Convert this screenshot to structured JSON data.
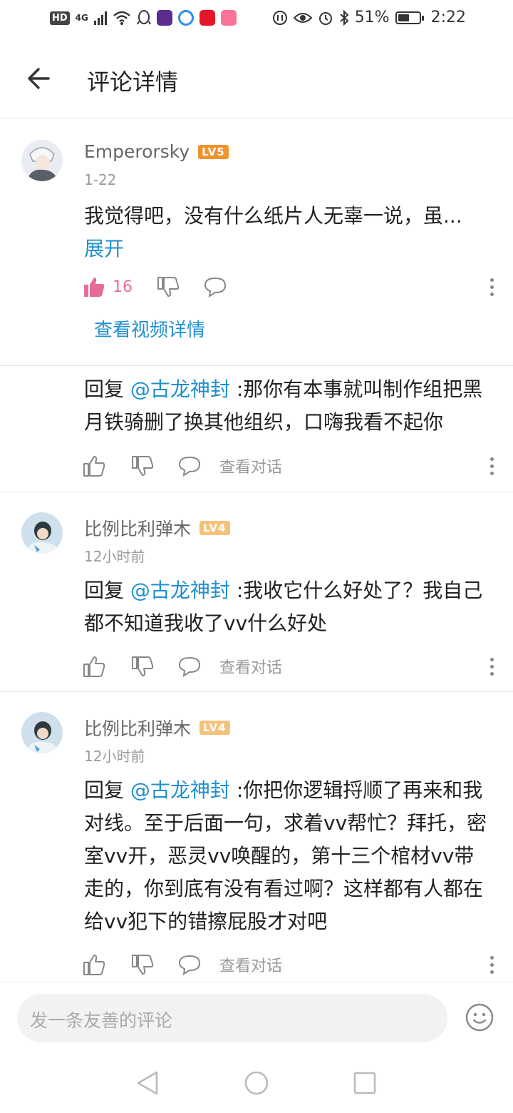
{
  "status_bar": {
    "hd": "HD",
    "network": "4G",
    "battery": "51%",
    "battery_level": 0.51,
    "time": "2:22"
  },
  "header": {
    "title": "评论详情"
  },
  "comments": [
    {
      "user": "Emperorsky",
      "level": "LV5",
      "level_color": "#f0932b",
      "date": "1-22",
      "text": "我觉得吧，没有什么纸片人无辜一说，虽...",
      "expand": "展开",
      "likes": "16",
      "video_link": "查看视频详情"
    },
    {
      "reply_prefix": "回复 ",
      "mention": "@古龙神封",
      "text": " :那你有本事就叫制作组把黑月铁骑删了换其他组织，口嗨我看不起你",
      "view_conversation": "查看对话"
    },
    {
      "user": "比例比利弹木",
      "level": "LV4",
      "level_color": "#f5c27a",
      "date": "12小时前",
      "reply_prefix": "回复 ",
      "mention": "@古龙神封",
      "text": " :我收它什么好处了？我自己都不知道我收了vv什么好处",
      "view_conversation": "查看对话"
    },
    {
      "user": "比例比利弹木",
      "level": "LV4",
      "level_color": "#f5c27a",
      "date": "12小时前",
      "reply_prefix": "回复 ",
      "mention": "@古龙神封",
      "text": " :你把你逻辑捋顺了再来和我对线。至于后面一句，求着vv帮忙？拜托，密室vv开，恶灵vv唤醒的，第十三个棺材vv带走的，你到底有没有看过啊？这样都有人都在给vv犯下的错擦屁股才对吧",
      "view_conversation": "查看对话"
    }
  ],
  "input": {
    "placeholder": "发一条友善的评论"
  },
  "colors": {
    "accent_blue": "#1f8fcf",
    "like_pink": "#e66b99",
    "lv5": "#f0932b",
    "lv4": "#f5c27a"
  },
  "icons": [
    "back-arrow-icon",
    "thumbs-up-icon",
    "thumbs-down-icon",
    "comment-bubble-icon",
    "more-vertical-icon",
    "emoji-icon",
    "nav-back-icon",
    "nav-home-icon",
    "nav-recents-icon"
  ]
}
